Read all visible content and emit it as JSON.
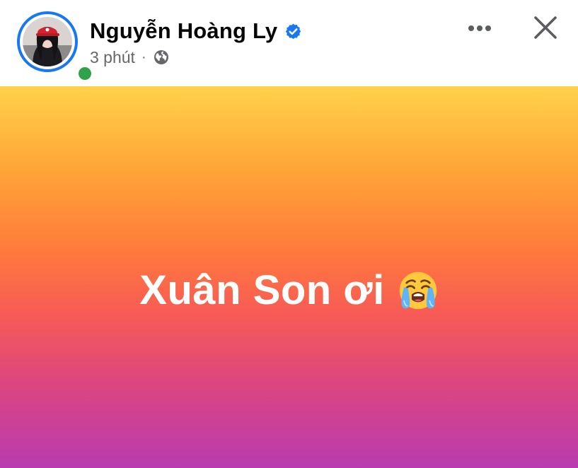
{
  "author": {
    "name": "Nguyễn Hoàng Ly",
    "verified": true,
    "online": true,
    "avatar_icon": "profile-photo"
  },
  "meta": {
    "time": "3 phút",
    "separator": "·",
    "privacy_icon": "globe-icon"
  },
  "actions": {
    "more_icon": "more-horizontal-icon",
    "close_icon": "close-icon"
  },
  "status": {
    "text": "Xuân Son ơi",
    "emoji_icon": "loudly-crying-face-emoji",
    "gradient_colors": [
      "#FFD24A",
      "#FFA437",
      "#FF7C3B",
      "#F75A56",
      "#DC4680",
      "#B93BB0"
    ]
  },
  "colors": {
    "accent": "#1877F2",
    "online": "#31A24C",
    "secondary_text": "#65676B",
    "primary_text": "#050505"
  }
}
